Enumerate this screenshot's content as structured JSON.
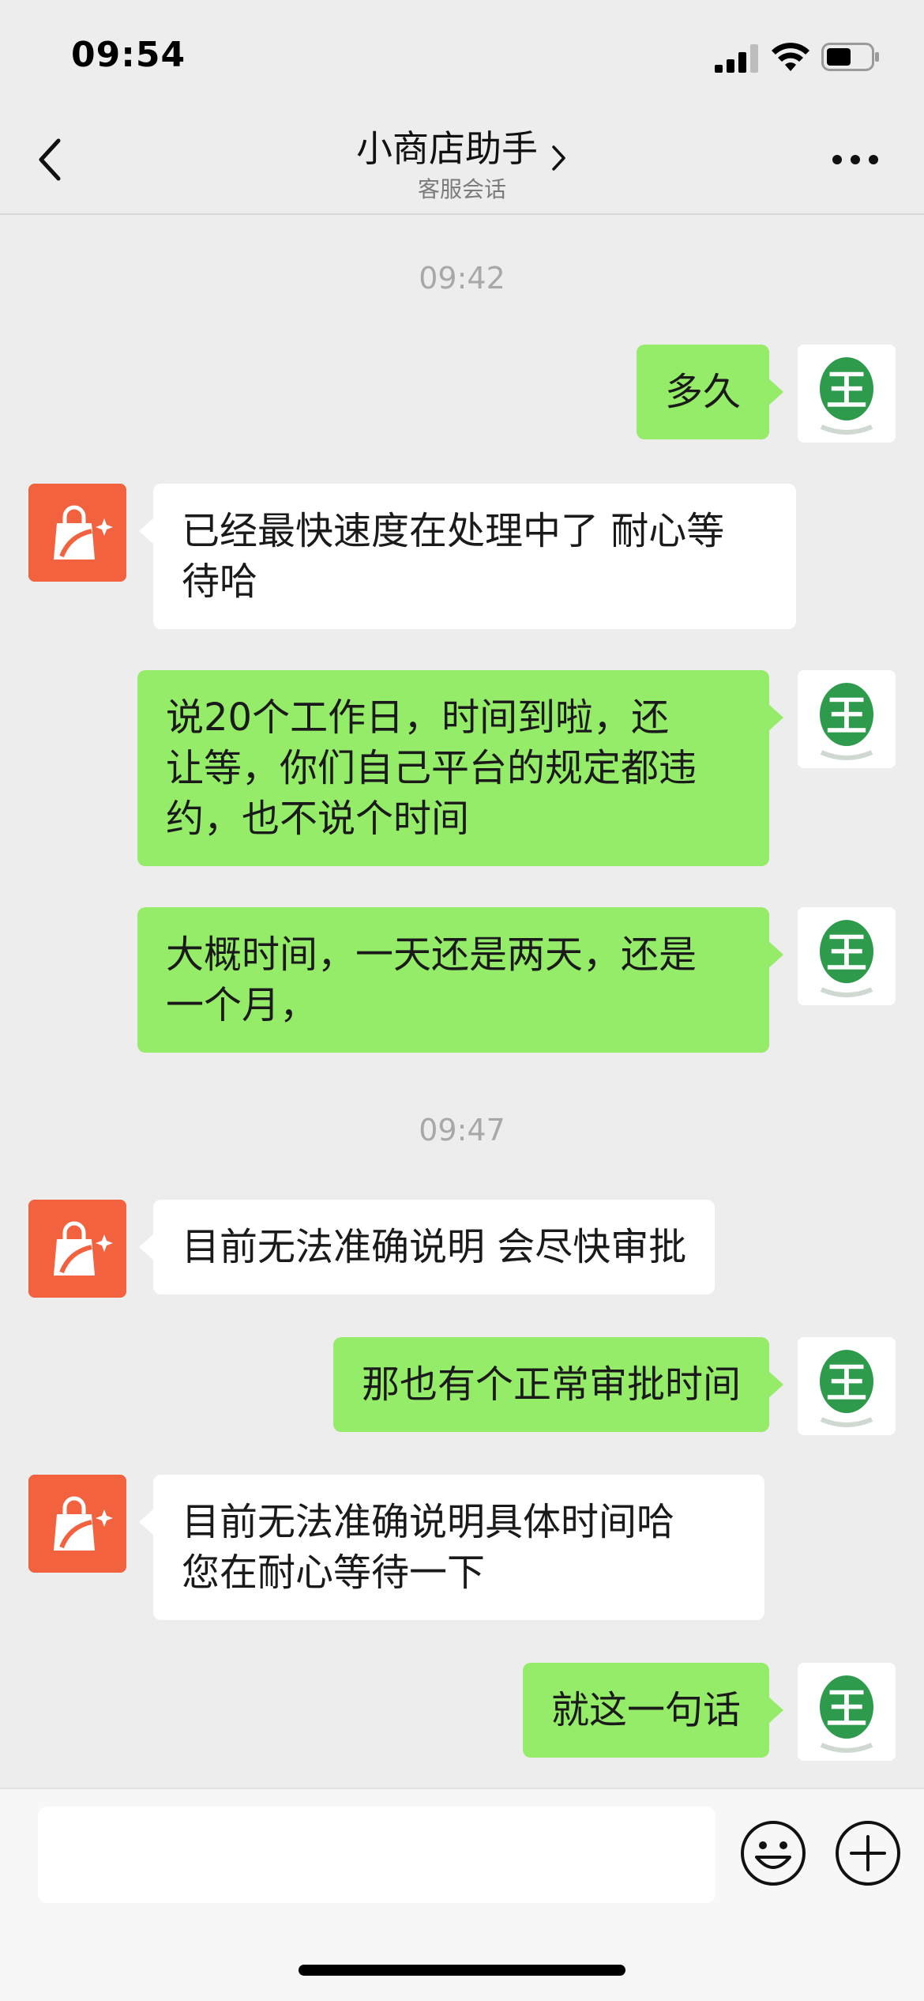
{
  "status_bar": {
    "time": "09:54"
  },
  "header": {
    "title": "小商店助手",
    "subtitle": "客服会话"
  },
  "icons": {
    "signal": "cellular-signal-icon",
    "wifi": "wifi-icon",
    "battery": "battery-icon",
    "back": "back-chevron-icon",
    "more": "more-dots-icon",
    "emoji": "emoji-icon",
    "plus": "plus-icon",
    "shop_avatar": "shopping-bag-icon",
    "user_avatar": "jade-logo-icon"
  },
  "colors": {
    "outgoing_bubble": "#95ec69",
    "incoming_bubble": "#ffffff",
    "shop_avatar_bg": "#f2623f",
    "background": "#ededed"
  },
  "chat": {
    "timestamps": [
      "09:42",
      "09:47"
    ],
    "messages": [
      {
        "from": "user",
        "text": "多久"
      },
      {
        "from": "shop",
        "text": "已经最快速度在处理中了 耐心等\n待哈"
      },
      {
        "from": "user",
        "text": "说20个工作日，时间到啦，还\n让等，你们自己平台的规定都违\n约，也不说个时间"
      },
      {
        "from": "user",
        "text": "大概时间，一天还是两天，还是\n一个月，"
      },
      {
        "from": "shop",
        "text": "目前无法准确说明  会尽快审批"
      },
      {
        "from": "user",
        "text": "那也有个正常审批时间"
      },
      {
        "from": "shop",
        "text": "目前无法准确说明具体时间哈\n您在耐心等待一下"
      },
      {
        "from": "user",
        "text": "就这一句话"
      }
    ]
  },
  "input": {
    "value": ""
  }
}
